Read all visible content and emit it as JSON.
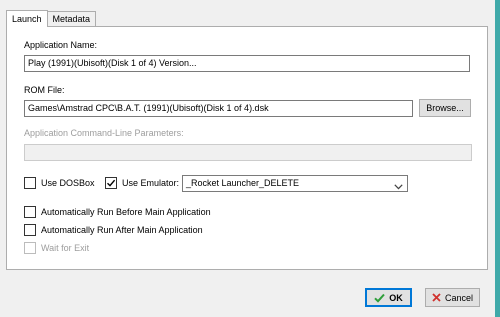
{
  "tabs": [
    {
      "label": "Launch",
      "active": true
    },
    {
      "label": "Metadata",
      "active": false
    }
  ],
  "application_name": {
    "label": "Application Name:",
    "value": "Play (1991)(Ubisoft)(Disk 1 of 4) Version..."
  },
  "rom_file": {
    "label": "ROM File:",
    "value": "Games\\Amstrad CPC\\B.A.T. (1991)(Ubisoft)(Disk 1 of 4).dsk",
    "browse_label": "Browse..."
  },
  "command_line": {
    "label": "Application Command-Line Parameters:",
    "value": "",
    "enabled": false
  },
  "use_dosbox": {
    "label": "Use DOSBox",
    "checked": false
  },
  "use_emulator": {
    "label": "Use Emulator:",
    "checked": true
  },
  "emulator_select": {
    "value": "_Rocket Launcher_DELETE",
    "icon": "chevron-down-icon"
  },
  "run_before": {
    "label": "Automatically Run Before Main Application",
    "checked": false
  },
  "run_after": {
    "label": "Automatically Run After Main Application",
    "checked": false
  },
  "wait_for_exit": {
    "label": "Wait for Exit",
    "checked": false,
    "enabled": false
  },
  "footer": {
    "ok_label": "OK",
    "cancel_label": "Cancel",
    "ok_icon": "check-icon",
    "cancel_icon": "x-icon"
  },
  "colors": {
    "accent": "#0078d7",
    "ok_check": "#2e9e3a",
    "cancel_x": "#d0312d",
    "window_edge": "#3fa9a9"
  }
}
